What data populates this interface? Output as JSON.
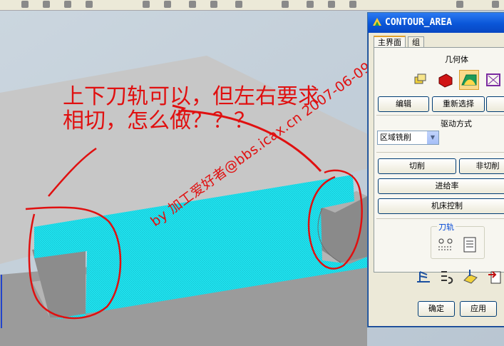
{
  "dialog": {
    "title": "CONTOUR_AREA",
    "tabs": [
      {
        "label": "主界面",
        "active": true
      },
      {
        "label": "组",
        "active": false
      }
    ],
    "geometry_label": "几何体",
    "edit_button": "编辑",
    "reselect_button": "重新选择",
    "drive_method_label": "驱动方式",
    "drive_method_value": "区域铣削",
    "cutting_button": "切削",
    "non_cutting_button": "非切削",
    "feedrate_button": "进给率",
    "machine_control_button": "机床控制",
    "toolpath_group_label": "刀轨",
    "ok_button": "确定",
    "apply_button": "应用"
  },
  "annotation": {
    "question": "上下刀轨可以，但左右要求相切，怎么做？？？",
    "watermark": "by 加工爱好者@bbs.icax.cn 2007-06-09"
  },
  "colors": {
    "toolpath": "#21e6f2",
    "ink": "#e01010",
    "titlebar": "#0a56d8",
    "part_top": "#c7c7c7",
    "part_face": "#8f8f8f",
    "background": "#c9d4dd"
  }
}
